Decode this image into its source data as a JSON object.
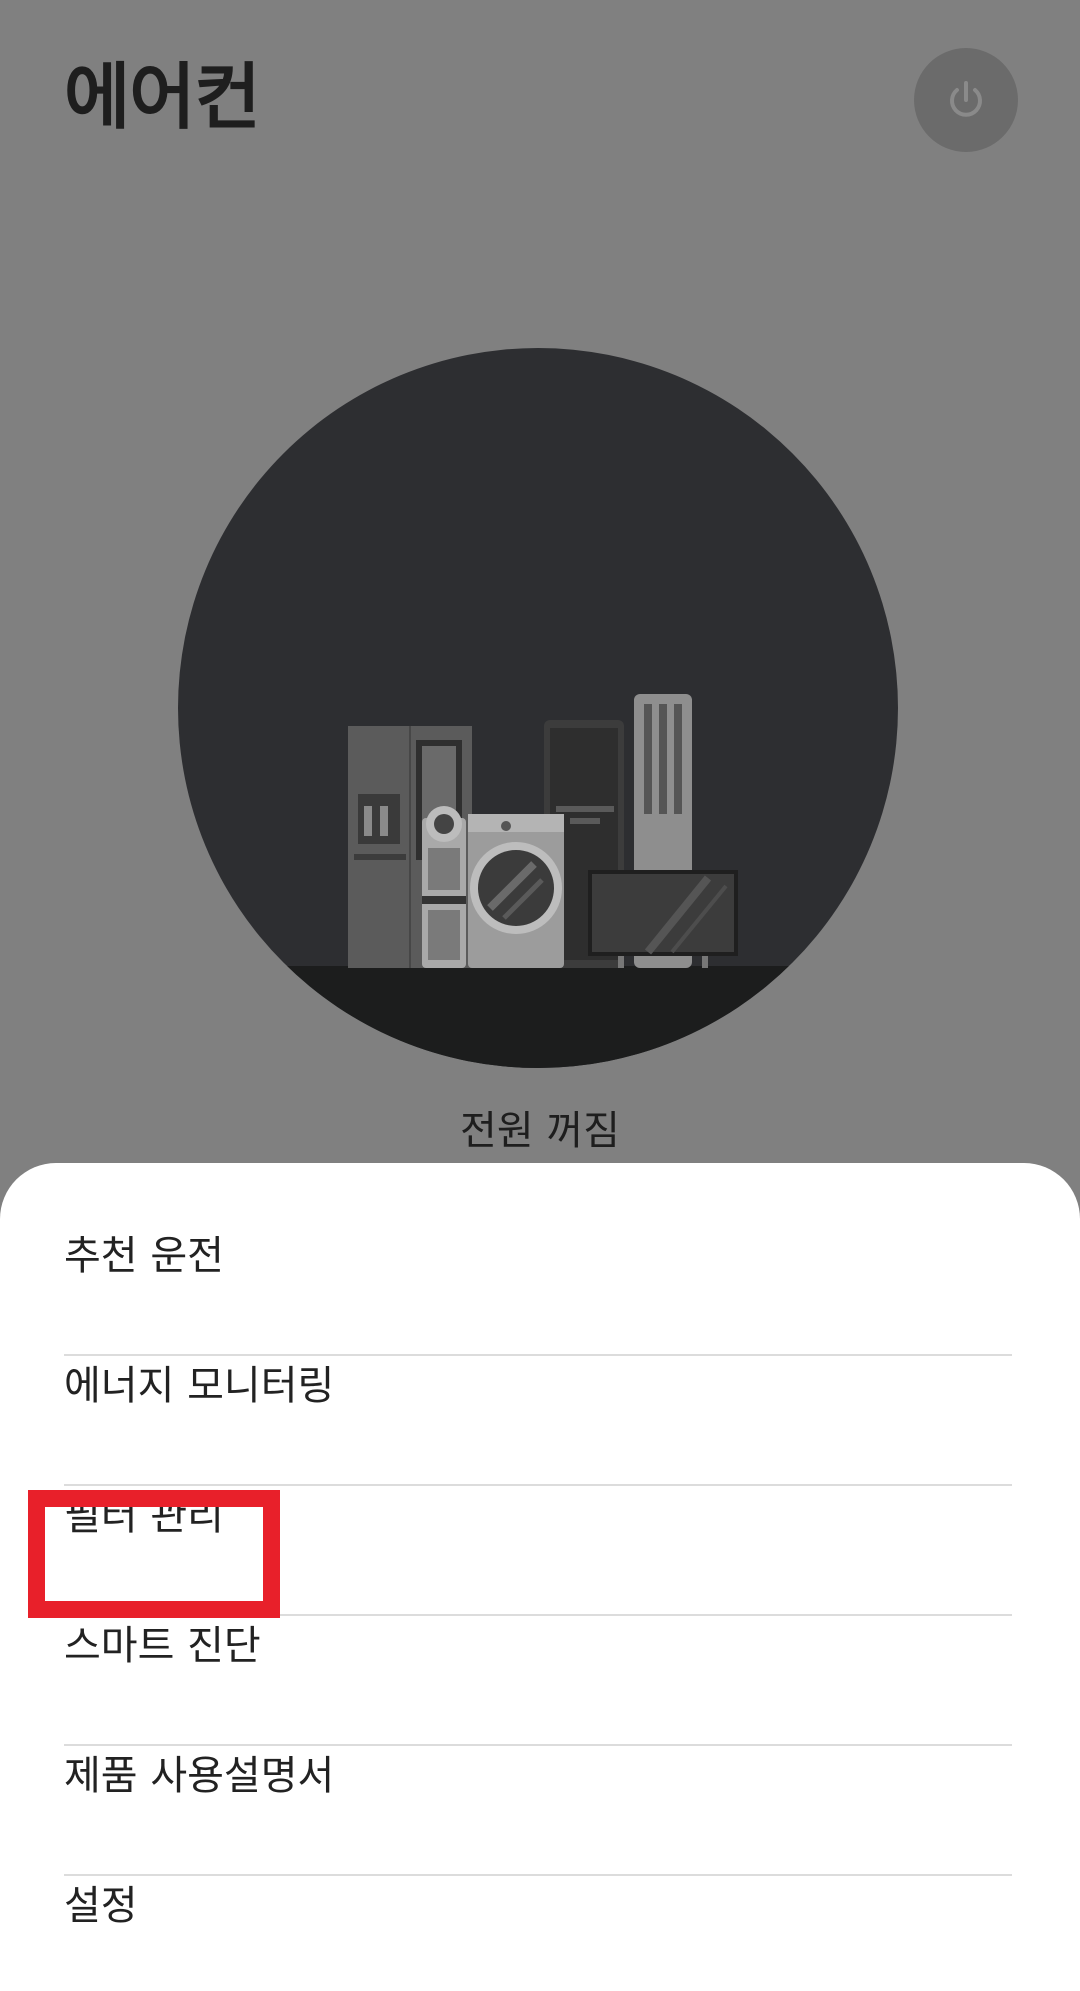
{
  "header": {
    "title": "에어컨",
    "power_icon": "power-icon"
  },
  "device": {
    "status": "전원 꺼짐"
  },
  "menu": {
    "items": [
      {
        "label": "추천 운전"
      },
      {
        "label": "에너지 모니터링"
      },
      {
        "label": "필터 관리"
      },
      {
        "label": "스마트 진단"
      },
      {
        "label": "제품 사용설명서"
      },
      {
        "label": "설정"
      }
    ]
  },
  "colors": {
    "overlay": "#808080",
    "circle": "#2d2e31",
    "highlight": "#e8202a",
    "sheet": "#ffffff"
  }
}
